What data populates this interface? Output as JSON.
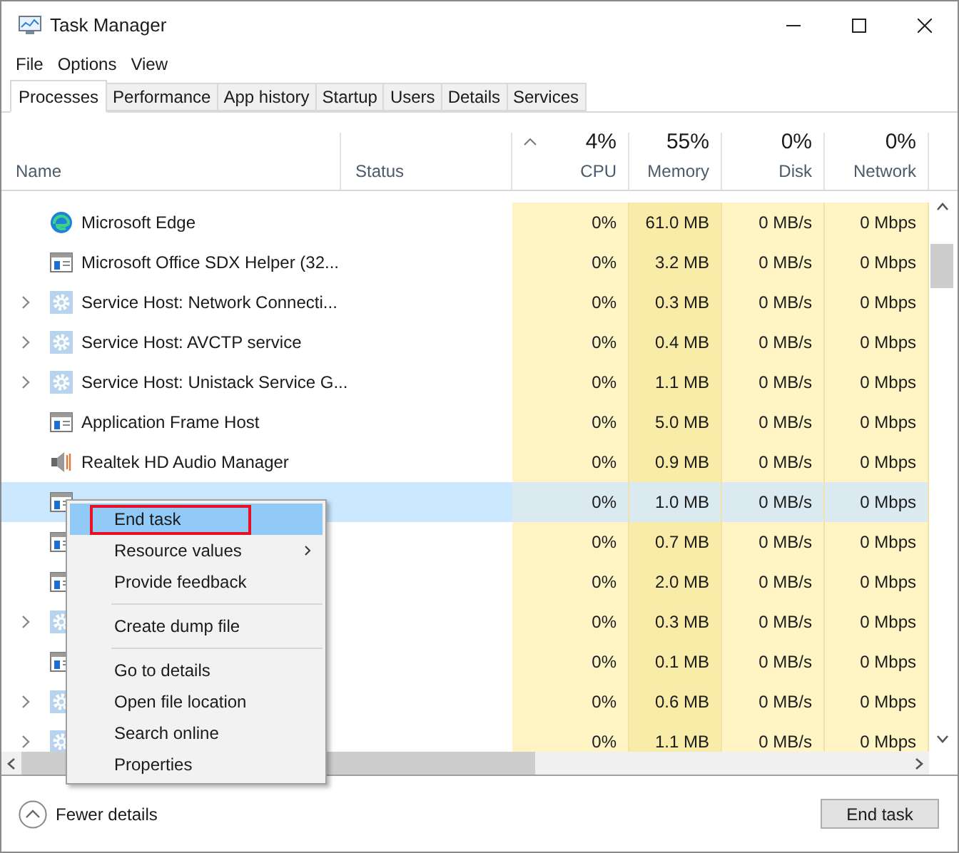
{
  "window": {
    "title": "Task Manager"
  },
  "menu": [
    "File",
    "Options",
    "View"
  ],
  "tabs": [
    {
      "label": "Processes",
      "selected": true
    },
    {
      "label": "Performance",
      "selected": false
    },
    {
      "label": "App history",
      "selected": false
    },
    {
      "label": "Startup",
      "selected": false
    },
    {
      "label": "Users",
      "selected": false
    },
    {
      "label": "Details",
      "selected": false
    },
    {
      "label": "Services",
      "selected": false
    }
  ],
  "columns": [
    {
      "kind": "text",
      "label": "Name"
    },
    {
      "kind": "text",
      "label": "Status"
    },
    {
      "kind": "metric",
      "label": "CPU",
      "total": "4%",
      "sorted": true,
      "color": "#fff4c4"
    },
    {
      "kind": "metric",
      "label": "Memory",
      "total": "55%",
      "sorted": false,
      "color": "#f9eba8"
    },
    {
      "kind": "metric",
      "label": "Disk",
      "total": "0%",
      "sorted": false,
      "color": "#fff4c4"
    },
    {
      "kind": "metric",
      "label": "Network",
      "total": "0%",
      "sorted": false,
      "color": "#fff4c4"
    }
  ],
  "rows": [
    {
      "kind": "edge",
      "expandable": false,
      "selected": false,
      "name": "Microsoft Edge",
      "values": [
        "0%",
        "61.0 MB",
        "0 MB/s",
        "0 Mbps"
      ]
    },
    {
      "kind": "window",
      "expandable": false,
      "selected": false,
      "name": "Microsoft Office SDX Helper (32...",
      "values": [
        "0%",
        "3.2 MB",
        "0 MB/s",
        "0 Mbps"
      ]
    },
    {
      "kind": "gear",
      "expandable": true,
      "selected": false,
      "name": "Service Host: Network Connecti...",
      "values": [
        "0%",
        "0.3 MB",
        "0 MB/s",
        "0 Mbps"
      ]
    },
    {
      "kind": "gear",
      "expandable": true,
      "selected": false,
      "name": "Service Host: AVCTP service",
      "values": [
        "0%",
        "0.4 MB",
        "0 MB/s",
        "0 Mbps"
      ]
    },
    {
      "kind": "gear",
      "expandable": true,
      "selected": false,
      "name": "Service Host: Unistack Service G...",
      "values": [
        "0%",
        "1.1 MB",
        "0 MB/s",
        "0 Mbps"
      ]
    },
    {
      "kind": "window",
      "expandable": false,
      "selected": false,
      "name": "Application Frame Host",
      "values": [
        "0%",
        "5.0 MB",
        "0 MB/s",
        "0 Mbps"
      ]
    },
    {
      "kind": "speaker",
      "expandable": false,
      "selected": false,
      "name": "Realtek HD Audio Manager",
      "values": [
        "0%",
        "0.9 MB",
        "0 MB/s",
        "0 Mbps"
      ]
    },
    {
      "kind": "window",
      "expandable": false,
      "selected": true,
      "values": [
        "0%",
        "1.0 MB",
        "0 MB/s",
        "0 Mbps"
      ]
    },
    {
      "kind": "window",
      "expandable": false,
      "selected": false,
      "values": [
        "0%",
        "0.7 MB",
        "0 MB/s",
        "0 Mbps"
      ]
    },
    {
      "kind": "window",
      "expandable": false,
      "selected": false,
      "values": [
        "0%",
        "2.0 MB",
        "0 MB/s",
        "0 Mbps"
      ]
    },
    {
      "kind": "gear",
      "expandable": true,
      "selected": false,
      "values": [
        "0%",
        "0.3 MB",
        "0 MB/s",
        "0 Mbps"
      ]
    },
    {
      "kind": "window",
      "expandable": false,
      "selected": false,
      "values": [
        "0%",
        "0.1 MB",
        "0 MB/s",
        "0 Mbps"
      ]
    },
    {
      "kind": "gear",
      "expandable": true,
      "selected": false,
      "values": [
        "0%",
        "0.6 MB",
        "0 MB/s",
        "0 Mbps"
      ]
    },
    {
      "kind": "gear",
      "expandable": true,
      "selected": false,
      "values": [
        "0%",
        "1.1 MB",
        "0 MB/s",
        "0 Mbps"
      ]
    }
  ],
  "context_menu": [
    {
      "label": "End task",
      "selected": true,
      "annotated": true,
      "submenu": false,
      "separator_after": false
    },
    {
      "label": "Resource values",
      "selected": false,
      "annotated": false,
      "submenu": true,
      "separator_after": false
    },
    {
      "label": "Provide feedback",
      "selected": false,
      "annotated": false,
      "submenu": false,
      "separator_after": true
    },
    {
      "label": "Create dump file",
      "selected": false,
      "annotated": false,
      "submenu": false,
      "separator_after": true
    },
    {
      "label": "Go to details",
      "selected": false,
      "annotated": false,
      "submenu": false,
      "separator_after": false
    },
    {
      "label": "Open file location",
      "selected": false,
      "annotated": false,
      "submenu": false,
      "separator_after": false
    },
    {
      "label": "Search online",
      "selected": false,
      "annotated": false,
      "submenu": false,
      "separator_after": false
    },
    {
      "label": "Properties",
      "selected": false,
      "annotated": false,
      "submenu": false,
      "separator_after": false
    }
  ],
  "footer": {
    "toggle": "Fewer details",
    "button": "End task"
  }
}
